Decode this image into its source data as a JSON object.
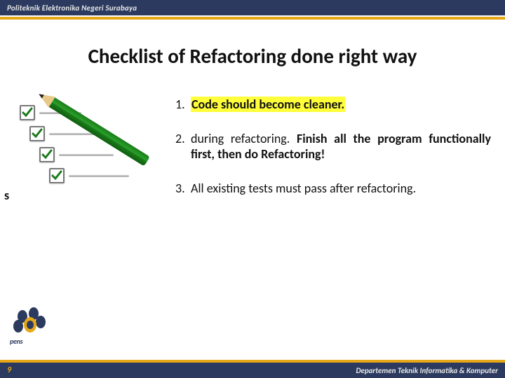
{
  "header": {
    "institution": "Politeknik Elektronika Negeri Surabaya"
  },
  "title": "Checklist of Refactoring done right way",
  "stray": "s",
  "items": {
    "n1": "1.",
    "t1": "Code should become cleaner.",
    "n2": "2.",
    "t2a": "during refactoring. ",
    "t2b": "Finish all the program functionally first, then do Refactoring!",
    "n3": "3.",
    "t3": "All existing tests must pass after refactoring."
  },
  "logo": {
    "text": "pens"
  },
  "footer": {
    "page": "9",
    "dept": "Departemen Teknik Informatika & Komputer"
  }
}
